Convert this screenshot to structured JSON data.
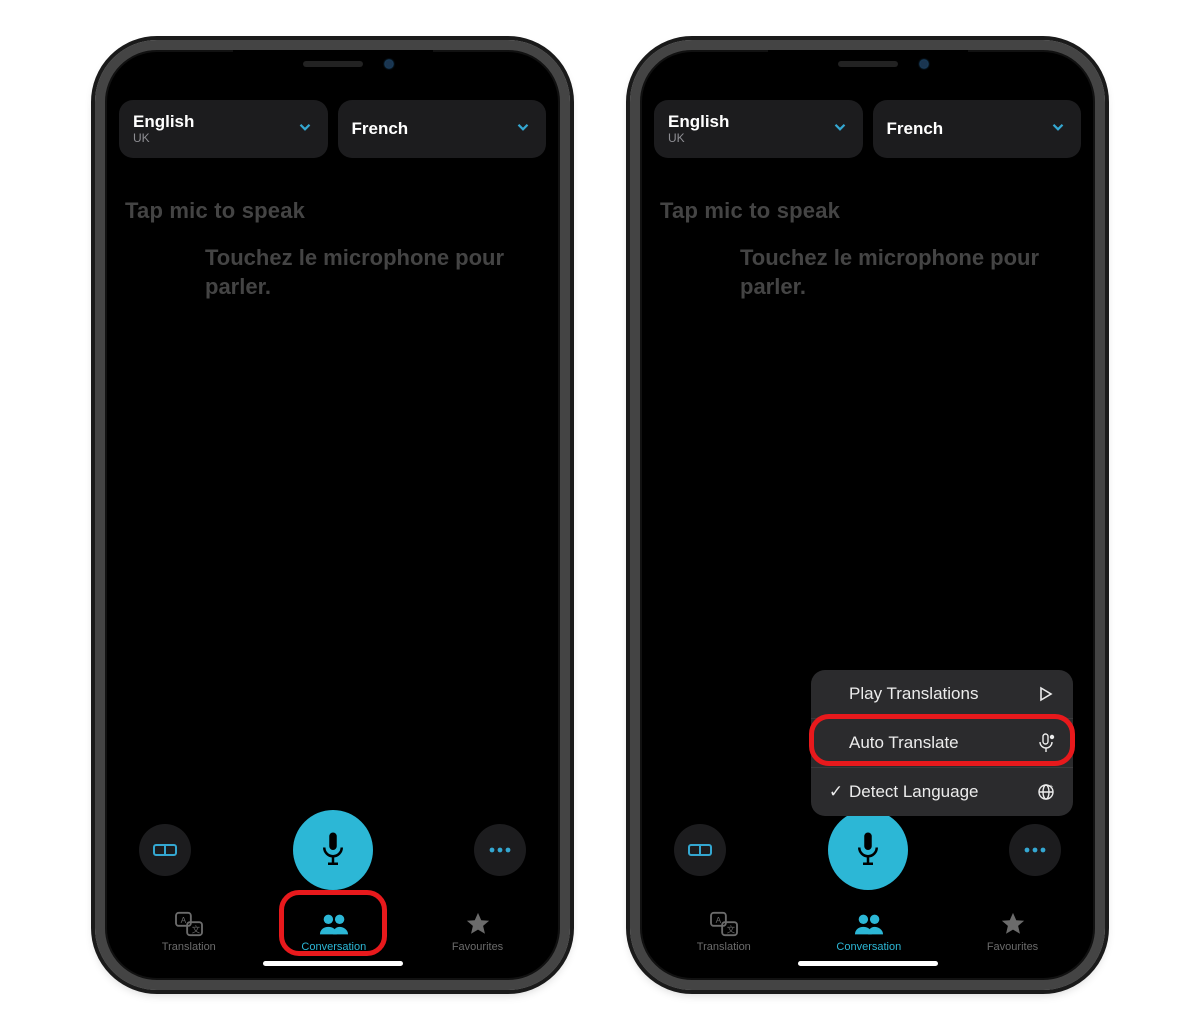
{
  "language_selectors": {
    "left": {
      "name": "English",
      "region": "UK"
    },
    "right": {
      "name": "French",
      "region": ""
    }
  },
  "prompts": {
    "primary": "Tap mic to speak",
    "secondary": "Touchez le microphone pour parler."
  },
  "controls": {
    "left_button": "face-to-face-icon",
    "mic_button": "microphone-icon",
    "right_button": "more-icon"
  },
  "tabs": [
    {
      "id": "translation",
      "label": "Translation",
      "active": false
    },
    {
      "id": "conversation",
      "label": "Conversation",
      "active": true
    },
    {
      "id": "favourites",
      "label": "Favourites",
      "active": false
    }
  ],
  "popup_menu": [
    {
      "checked": false,
      "label": "Play Translations",
      "icon": "play-icon"
    },
    {
      "checked": false,
      "label": "Auto Translate",
      "icon": "mic-auto-icon"
    },
    {
      "checked": true,
      "label": "Detect Language",
      "icon": "globe-icon"
    }
  ],
  "annotations": {
    "left_highlight": "Conversation tab",
    "right_highlight": "Auto Translate menu item"
  },
  "colors": {
    "accent": "#2cb7d6",
    "highlight": "#e8191c",
    "card": "#1c1c1e",
    "menu": "#2b2b2d"
  }
}
